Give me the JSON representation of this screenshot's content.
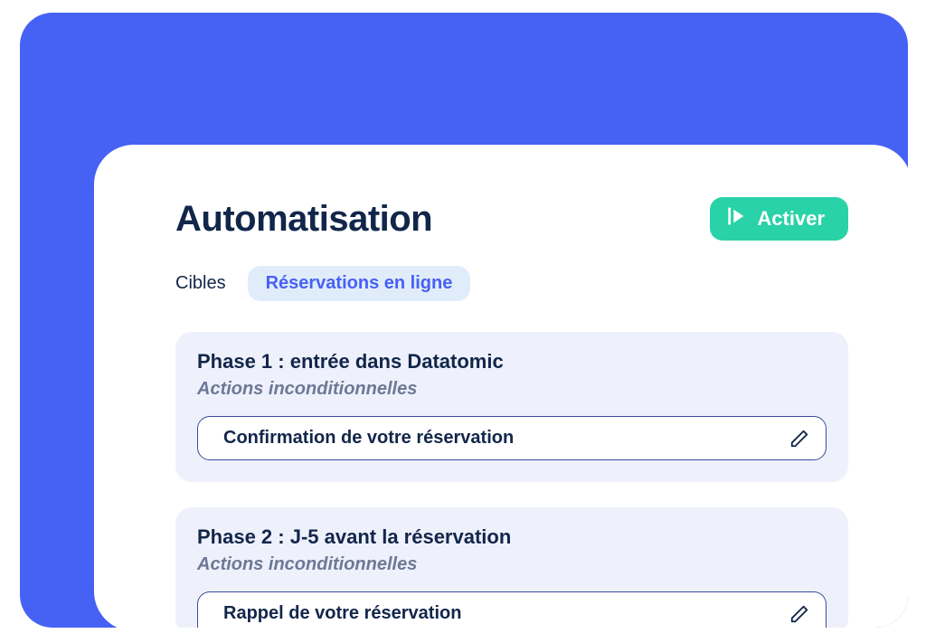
{
  "header": {
    "title": "Automatisation",
    "activate_label": "Activer"
  },
  "targets": {
    "label": "Cibles",
    "chip": "Réservations en ligne"
  },
  "phases": [
    {
      "title": "Phase 1 : entrée dans Datatomic",
      "subtitle": "Actions inconditionnelles",
      "action": "Confirmation de votre réservation"
    },
    {
      "title": "Phase 2 : J-5 avant la réservation",
      "subtitle": "Actions inconditionnelles",
      "action": "Rappel de votre réservation"
    }
  ],
  "colors": {
    "accent": "#4662F4",
    "activate": "#29D2A7",
    "text_dark": "#12264A"
  }
}
